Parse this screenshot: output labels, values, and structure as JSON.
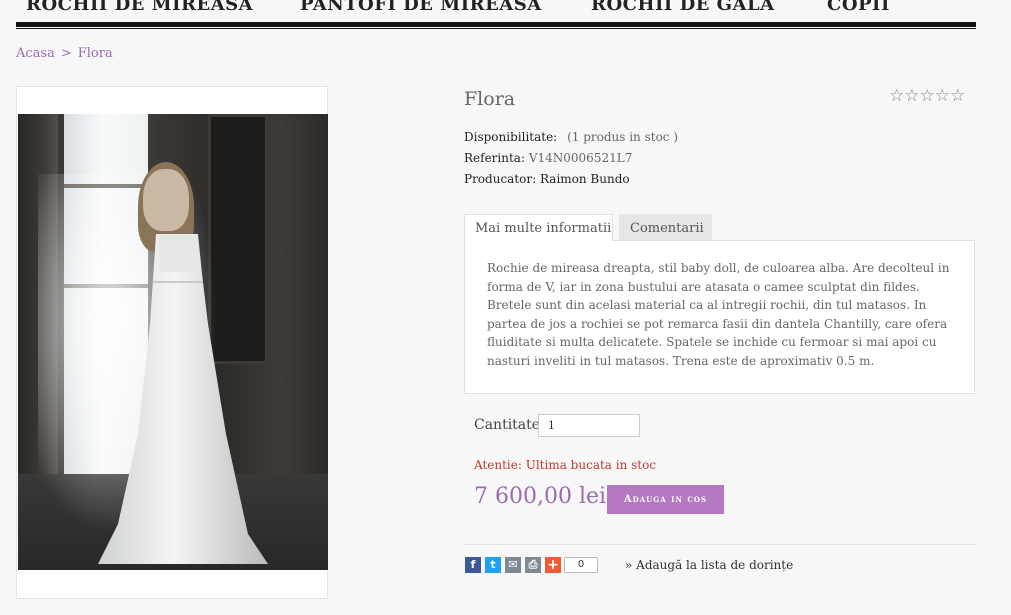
{
  "nav": {
    "items": [
      {
        "label": "ROCHII DE MIREASA"
      },
      {
        "label": "PANTOFI DE MIREASA"
      },
      {
        "label": "ROCHII DE GALA"
      },
      {
        "label": "COPII"
      }
    ]
  },
  "breadcrumb": {
    "home": "Acasa",
    "separator": ">",
    "current": "Flora"
  },
  "product": {
    "title": "Flora",
    "rating_stars": "☆☆☆☆☆",
    "availability_label": "Disponibilitate:",
    "availability_value": "(1 produs in stoc )",
    "reference_label": "Referinta:",
    "reference_value": "V14N0006521L7",
    "producer_label": "Producator:",
    "producer_value": "Raimon Bundo"
  },
  "tabs": {
    "more_info": "Mai multe informatii",
    "comments": "Comentarii",
    "description": "Rochie de mireasa dreapta, stil baby doll, de culoarea alba. Are decolteul in forma de V, iar in zona bustului are atasata o camee sculptat din fildes. Bretele sunt din acelasi material ca al intregii rochii, din tul matasos. In partea de jos a rochiei se pot remarca fasii din dantela Chantilly, care ofera fluiditate si multa delicatete. Spatele se inchide cu fermoar si mai apoi cu nasturi inveliti in tul matasos. Trena este de aproximativ 0.5 m."
  },
  "purchase": {
    "quantity_label": "Cantitate:",
    "quantity_value": "1",
    "warning": "Atentie: Ultima bucata in stoc",
    "price": "7 600,00 lei",
    "add_to_cart": "Adauga in cos"
  },
  "share": {
    "facebook_icon": "f",
    "twitter_icon": "t",
    "email_icon": "✉",
    "print_icon": "⎙",
    "add_icon": "+",
    "count": "0",
    "wishlist": "» Adaugă la lista de dorințe"
  },
  "colors": {
    "accent": "#b579c1",
    "link": "#9b6bb0",
    "warning": "#c0392b"
  }
}
